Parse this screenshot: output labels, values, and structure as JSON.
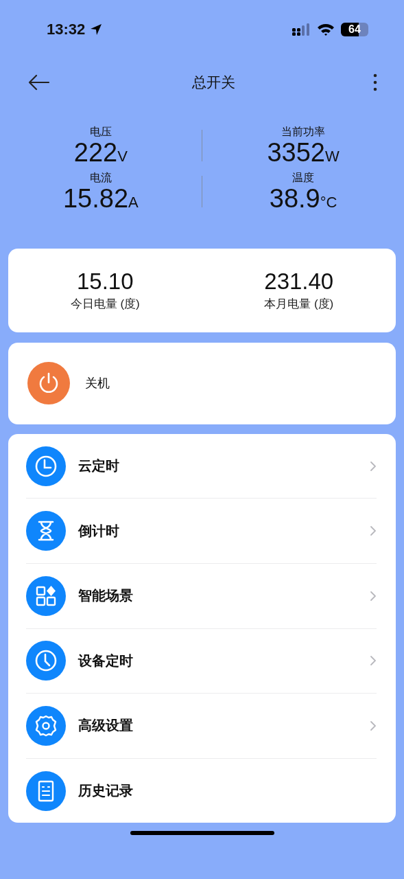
{
  "status_bar": {
    "time": "13:32",
    "battery": "64"
  },
  "header": {
    "title": "总开关"
  },
  "metrics": [
    {
      "label": "电压",
      "value": "222",
      "unit": "V"
    },
    {
      "label": "当前功率",
      "value": "3352",
      "unit": "W"
    },
    {
      "label": "电流",
      "value": "15.82",
      "unit": "A"
    },
    {
      "label": "温度",
      "value": "38.9",
      "unit": "°C"
    }
  ],
  "energy": [
    {
      "value": "15.10",
      "label": "今日电量 (度)"
    },
    {
      "value": "231.40",
      "label": "本月电量 (度)"
    }
  ],
  "power": {
    "label": "关机",
    "on": true
  },
  "menu": [
    {
      "kind": "timer",
      "label": "云定时",
      "chevron": true
    },
    {
      "kind": "hourglass",
      "label": "倒计时",
      "chevron": true
    },
    {
      "kind": "scene",
      "label": "智能场景",
      "chevron": true
    },
    {
      "kind": "clock",
      "label": "设备定时",
      "chevron": true
    },
    {
      "kind": "gear",
      "label": "高级设置",
      "chevron": true
    },
    {
      "kind": "log",
      "label": "历史记录",
      "chevron": false
    }
  ]
}
